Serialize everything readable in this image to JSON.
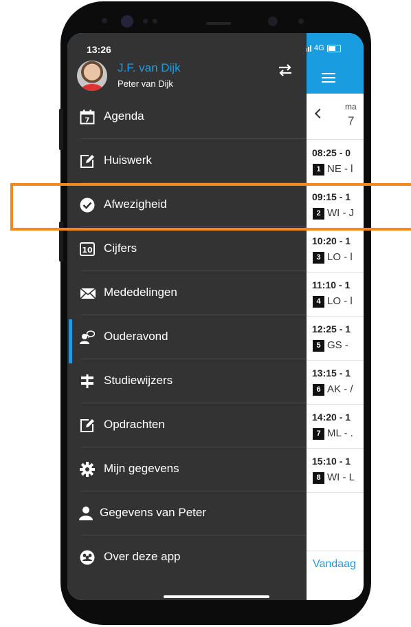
{
  "status_bar": {
    "time": "13:26",
    "network": "4G"
  },
  "user": {
    "name": "J.F. van Dijk",
    "child": "Peter van Dijk"
  },
  "menu": [
    {
      "id": "agenda",
      "label": "Agenda",
      "icon": "calendar-icon"
    },
    {
      "id": "huiswerk",
      "label": "Huiswerk",
      "icon": "edit-icon"
    },
    {
      "id": "afwezigheid",
      "label": "Afwezigheid",
      "icon": "check-circle-icon",
      "highlighted": true
    },
    {
      "id": "cijfers",
      "label": "Cijfers",
      "icon": "grade-10-icon"
    },
    {
      "id": "mededelingen",
      "label": "Mededelingen",
      "icon": "envelope-icon"
    },
    {
      "id": "ouderavond",
      "label": "Ouderavond",
      "icon": "person-chat-icon",
      "active": true
    },
    {
      "id": "studiewijzers",
      "label": "Studiewijzers",
      "icon": "signpost-icon"
    },
    {
      "id": "opdrachten",
      "label": "Opdrachten",
      "icon": "edit-icon"
    },
    {
      "id": "mijn-gegevens",
      "label": "Mijn gegevens",
      "icon": "gear-icon"
    },
    {
      "id": "gegevens-peter",
      "label": "Gegevens van Peter",
      "icon": "user-icon"
    },
    {
      "id": "over",
      "label": "Over deze app",
      "icon": "group-icon"
    }
  ],
  "schedule": {
    "day_abbr": "ma",
    "day_number": "7",
    "lessons": [
      {
        "time": "08:25 - 0",
        "hour": "1",
        "text": "NE - l"
      },
      {
        "time": "09:15 - 1",
        "hour": "2",
        "text": "WI - J"
      },
      {
        "time": "10:20 - 1",
        "hour": "3",
        "text": "LO - l"
      },
      {
        "time": "11:10 - 1",
        "hour": "4",
        "text": "LO - l"
      },
      {
        "time": "12:25 - 1",
        "hour": "5",
        "text": "GS - "
      },
      {
        "time": "13:15 - 1",
        "hour": "6",
        "text": "AK - /"
      },
      {
        "time": "14:20 - 1",
        "hour": "7",
        "text": "ML - ."
      },
      {
        "time": "15:10 - 1",
        "hour": "8",
        "text": "WI - L"
      }
    ],
    "today_button": "Vandaag"
  },
  "colors": {
    "accent": "#1a9de0",
    "drawer": "#333333",
    "highlight": "#f28a1b"
  }
}
